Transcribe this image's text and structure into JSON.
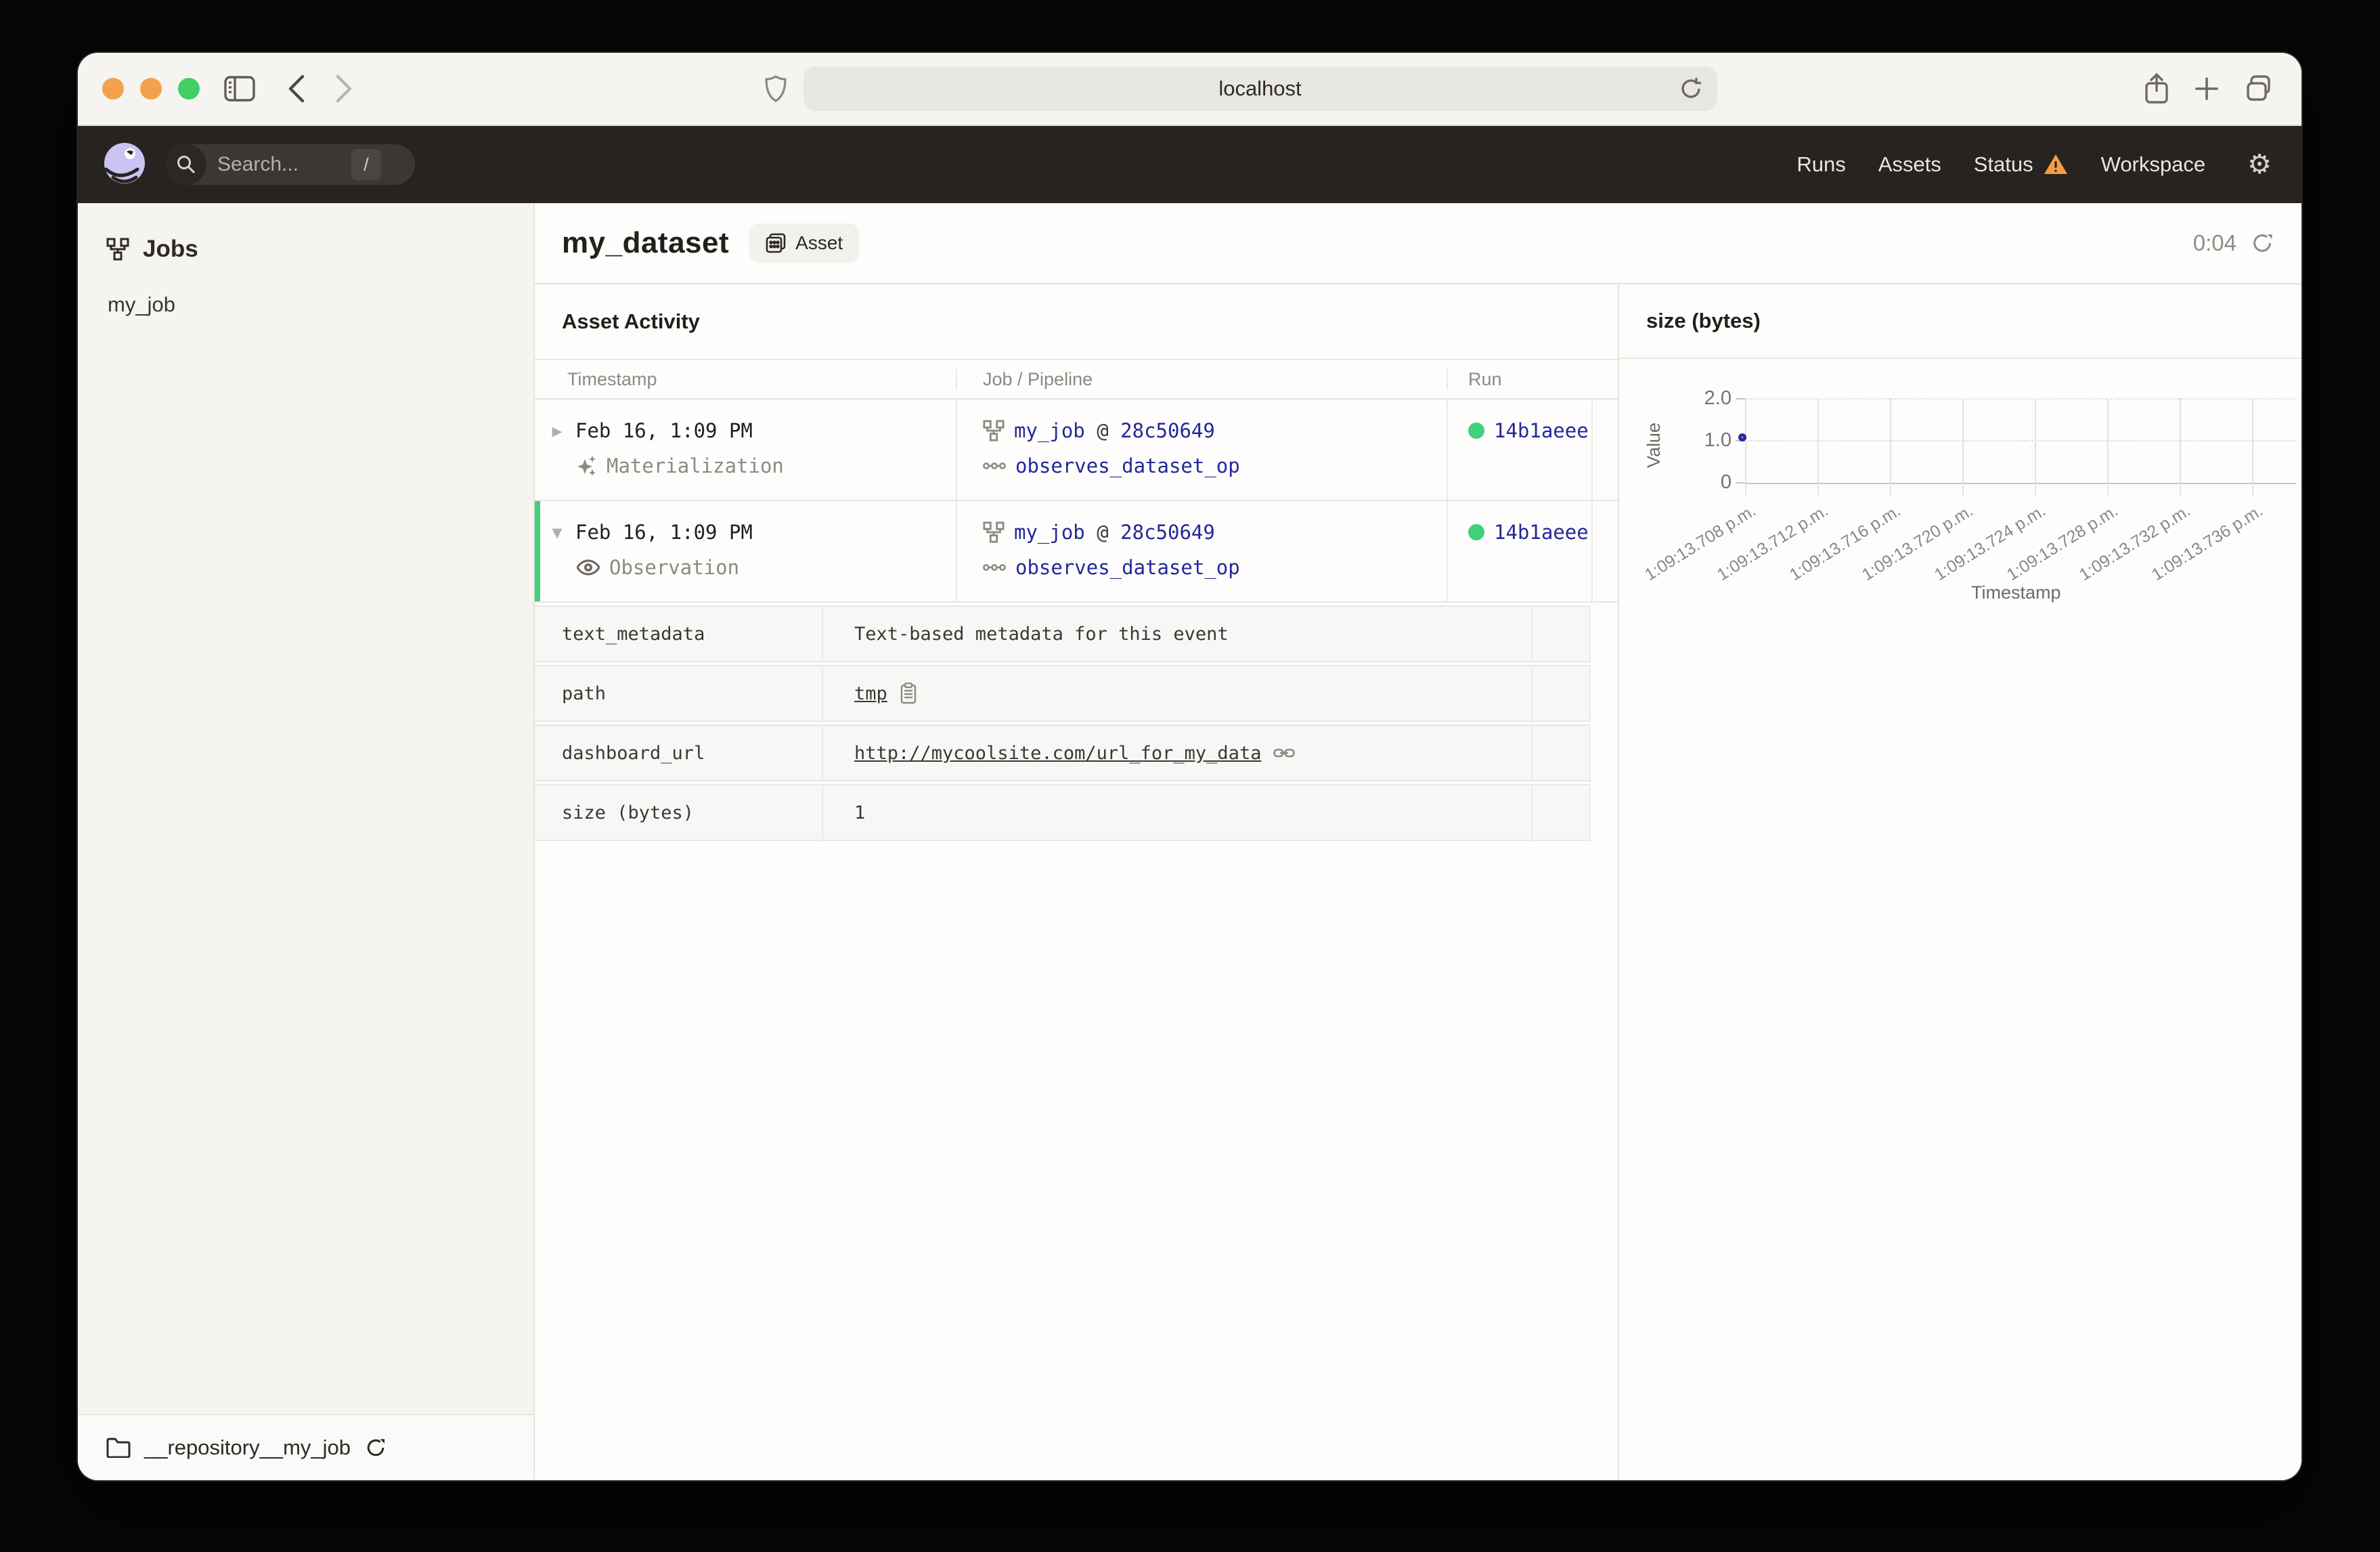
{
  "browser": {
    "url": "localhost",
    "traffic_lights": [
      "#f2a24a",
      "#f2a24a",
      "#3fcf64"
    ]
  },
  "app_header": {
    "search_placeholder": "Search...",
    "search_shortcut": "/",
    "nav": {
      "runs": "Runs",
      "assets": "Assets",
      "status": "Status",
      "workspace": "Workspace"
    }
  },
  "sidebar": {
    "section_title": "Jobs",
    "items": [
      {
        "label": "my_job"
      }
    ],
    "footer": {
      "repo_name": "__repository__my_job"
    }
  },
  "main": {
    "title": "my_dataset",
    "badge": "Asset",
    "timer": "0:04",
    "section_title": "Asset Activity",
    "table": {
      "columns": [
        "Timestamp",
        "Job / Pipeline",
        "Run"
      ],
      "rows": [
        {
          "timestamp": "Feb 16, 1:09 PM",
          "event_type": "Materialization",
          "job": "my_job",
          "at": "@",
          "run_tag": "28c50649",
          "op": "observes_dataset_op",
          "run_id": "14b1aeee",
          "expanded": false
        },
        {
          "timestamp": "Feb 16, 1:09 PM",
          "event_type": "Observation",
          "job": "my_job",
          "at": "@",
          "run_tag": "28c50649",
          "op": "observes_dataset_op",
          "run_id": "14b1aeee",
          "expanded": true
        }
      ],
      "metadata": [
        {
          "key": "text_metadata",
          "value": "Text-based metadata for this event"
        },
        {
          "key": "path",
          "value": "tmp"
        },
        {
          "key": "dashboard_url",
          "value": "http://mycoolsite.com/url_for_my_data"
        },
        {
          "key": "size (bytes)",
          "value": "1"
        }
      ]
    }
  },
  "chart_data": {
    "type": "scatter",
    "title": "size (bytes)",
    "xlabel": "Timestamp",
    "ylabel": "Value",
    "ylim": [
      0,
      2
    ],
    "y_ticks": [
      "2.0",
      "1.0",
      "0"
    ],
    "x_ticks": [
      "1:09:13.708 p.m.",
      "1:09:13.712 p.m.",
      "1:09:13.716 p.m.",
      "1:09:13.720 p.m.",
      "1:09:13.724 p.m.",
      "1:09:13.728 p.m.",
      "1:09:13.732 p.m.",
      "1:09:13.736 p.m."
    ],
    "grid": true,
    "points": [
      {
        "x": "1:09:13.708 p.m.",
        "y": 1
      }
    ]
  },
  "colors": {
    "run_success_green": "#3ed17a",
    "warning_orange": "#f49e42",
    "link_navy": "#23289a",
    "brand_lavender": "#c9c4f2",
    "header_dark": "#272320"
  }
}
